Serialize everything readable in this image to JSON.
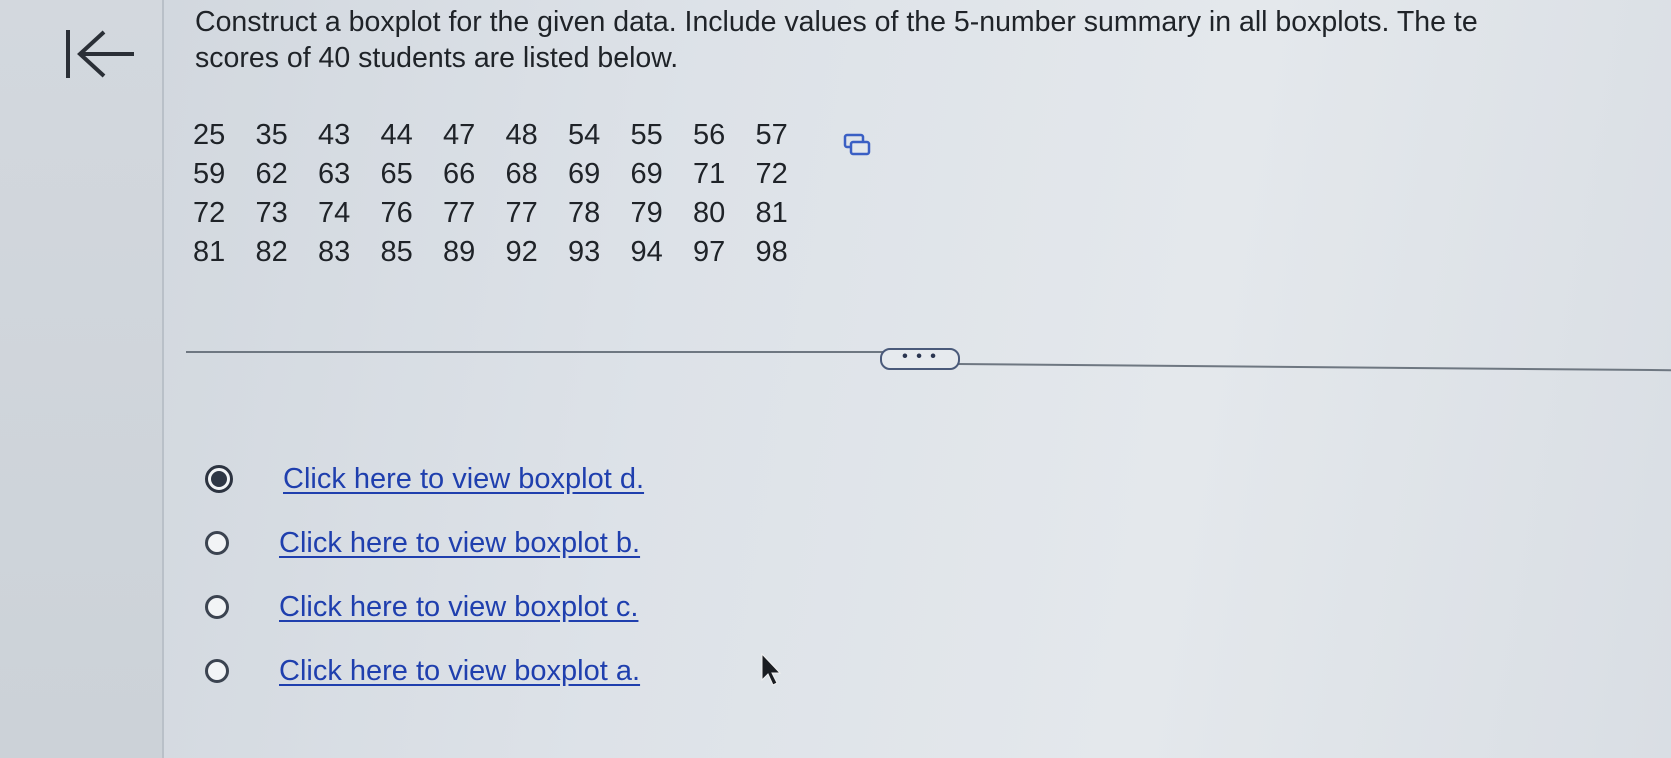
{
  "nav": {
    "back_icon": "collapse-left-icon"
  },
  "question": {
    "line1": "Construct a boxplot for the given data. Include values of the 5-number summary in all boxplots. The te",
    "line2": "scores of 40 students are listed below."
  },
  "data_rows": [
    [
      "25",
      "35",
      "43",
      "44",
      "47",
      "48",
      "54",
      "55",
      "56",
      "57"
    ],
    [
      "59",
      "62",
      "63",
      "65",
      "66",
      "68",
      "69",
      "69",
      "71",
      "72"
    ],
    [
      "72",
      "73",
      "74",
      "76",
      "77",
      "77",
      "78",
      "79",
      "80",
      "81"
    ],
    [
      "81",
      "82",
      "83",
      "85",
      "89",
      "92",
      "93",
      "94",
      "97",
      "98"
    ]
  ],
  "copy_icon": "copy-data-icon",
  "more_button": {
    "label": "• • •"
  },
  "options": [
    {
      "label": "Click here to view boxplot d.",
      "selected": true
    },
    {
      "label": "Click here to view boxplot b.",
      "selected": false
    },
    {
      "label": "Click here to view boxplot c.",
      "selected": false
    },
    {
      "label": "Click here to view boxplot a.",
      "selected": false
    }
  ],
  "colors": {
    "link": "#1f3fae",
    "text": "#1f2328",
    "divider": "#6e7781"
  }
}
